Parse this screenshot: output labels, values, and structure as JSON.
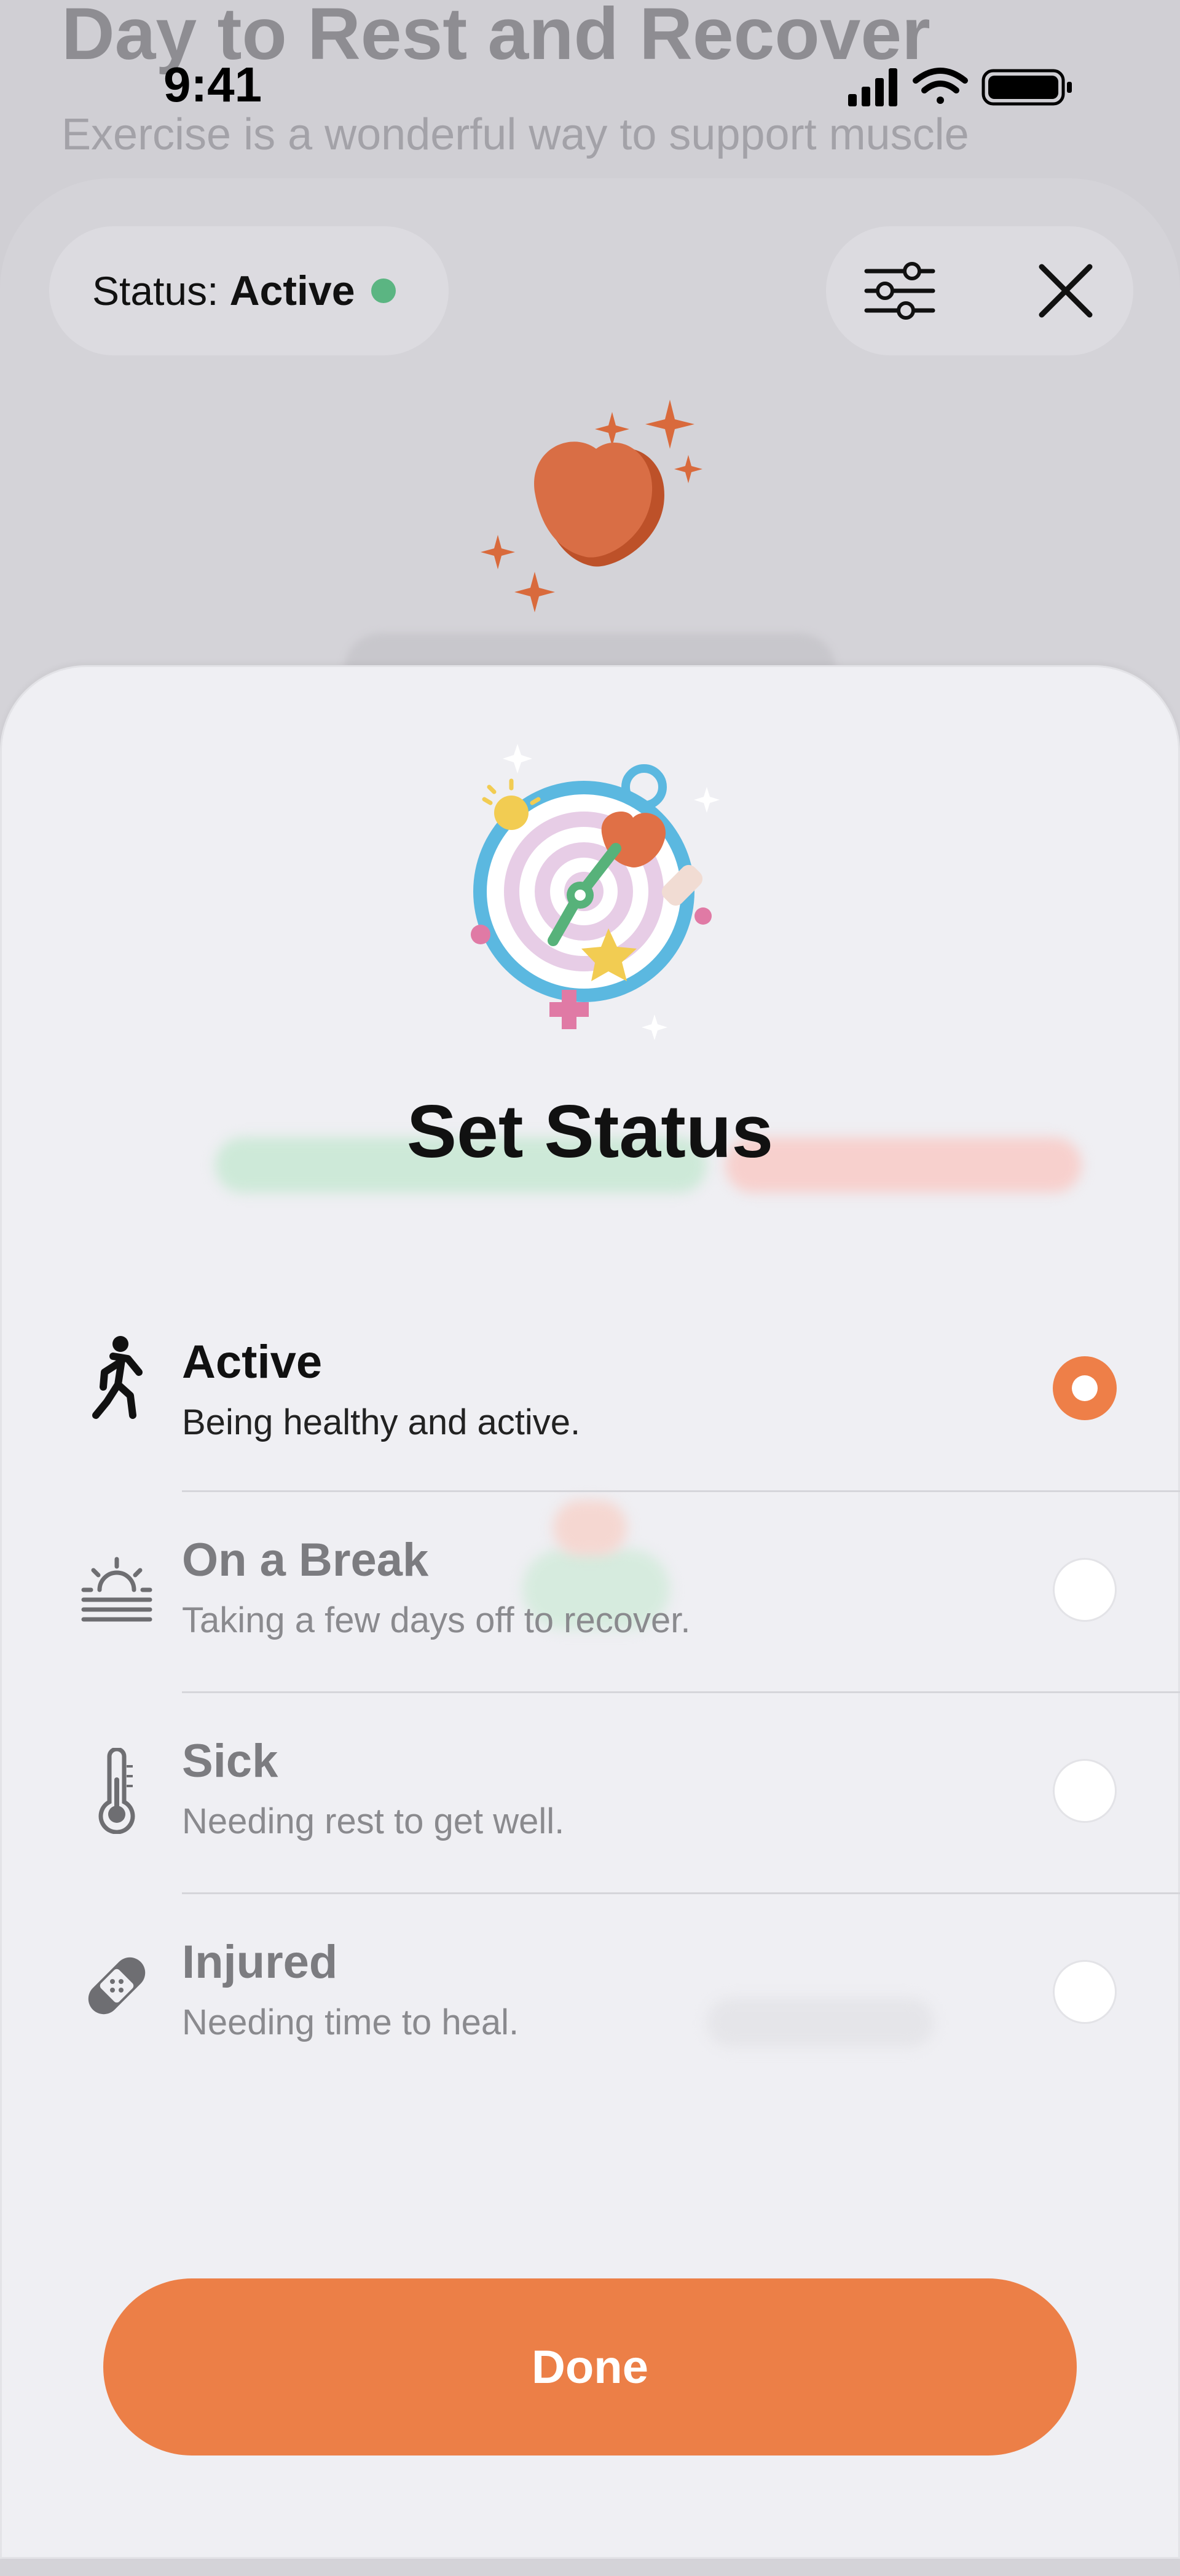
{
  "background": {
    "headline": "Day to Rest and Recover",
    "body": "Exercise is a wonderful way to support muscle"
  },
  "statusbar": {
    "time": "9:41"
  },
  "status_card": {
    "status_label": "Status:",
    "status_value": "Active",
    "status_color": "#5bb582",
    "filter_icon": "sliders-icon",
    "close_icon": "close-icon"
  },
  "sheet": {
    "title": "Set Status",
    "options": [
      {
        "label": "Active",
        "description": "Being healthy and active.",
        "icon": "walking-person-icon",
        "selected": true
      },
      {
        "label": "On a Break",
        "description": "Taking a few days off to recover.",
        "icon": "sunset-icon",
        "selected": false
      },
      {
        "label": "Sick",
        "description": "Needing rest to get well.",
        "icon": "thermometer-icon",
        "selected": false
      },
      {
        "label": "Injured",
        "description": "Needing time to heal.",
        "icon": "bandage-icon",
        "selected": false
      }
    ],
    "done_label": "Done"
  },
  "colors": {
    "accent": "#ec7f47",
    "active_green": "#5bb582"
  }
}
